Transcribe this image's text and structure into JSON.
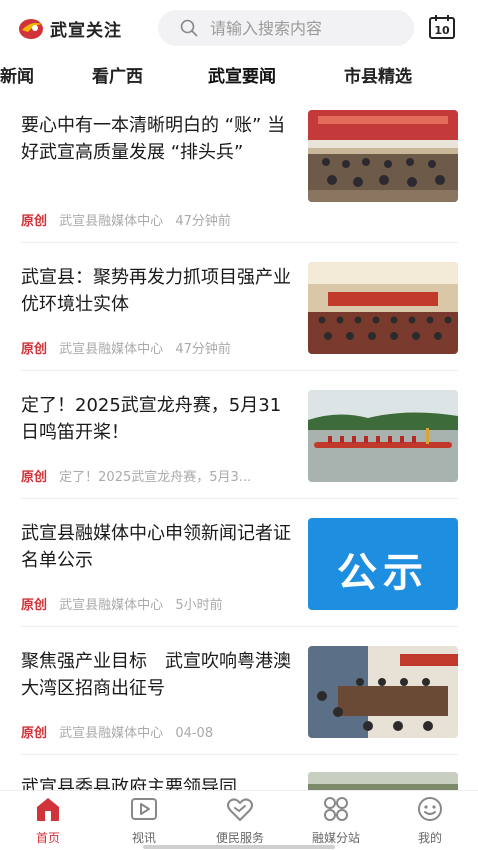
{
  "header": {
    "logo_text": "武宣关注",
    "search_placeholder": "请输入搜索内容",
    "calendar_day": "10"
  },
  "tabs": [
    {
      "label": "新闻"
    },
    {
      "label": "看广西"
    },
    {
      "label": "武宣要闻"
    },
    {
      "label": "市县精选"
    }
  ],
  "feed": [
    {
      "title": "要心中有一本清晰明白的 “账” 当好武宣高质量发展 “排头兵”",
      "tag": "原创",
      "source": "武宣县融媒体中心",
      "time": "47分钟前"
    },
    {
      "title": "武宣县：聚势再发力抓项目强产业优环境壮实体",
      "tag": "原创",
      "source": "武宣县融媒体中心",
      "time": "47分钟前"
    },
    {
      "title": "定了！2025武宣龙舟赛，5月31日鸣笛开桨！",
      "tag": "原创",
      "source": "定了！2025武宣龙舟赛，5月3...",
      "time": ""
    },
    {
      "title": "武宣县融媒体中心申领新闻记者证名单公示",
      "tag": "原创",
      "source": "武宣县融媒体中心",
      "time": "5小时前",
      "thumb_text": "公示"
    },
    {
      "title": "聚焦强产业目标　武宣吹响粤港澳大湾区招商出征号",
      "tag": "原创",
      "source": "武宣县融媒体中心",
      "time": "04-08"
    },
    {
      "title": "武宣县委县政府主要领导同",
      "tag": "",
      "source": "",
      "time": ""
    }
  ],
  "tabbar": [
    {
      "label": "首页",
      "icon": "home-icon"
    },
    {
      "label": "视讯",
      "icon": "video-icon"
    },
    {
      "label": "便民服务",
      "icon": "heart-service-icon"
    },
    {
      "label": "融媒分站",
      "icon": "grid-icon"
    },
    {
      "label": "我的",
      "icon": "smile-face-icon"
    }
  ],
  "colors": {
    "accent": "#d0333a",
    "meta": "#aaaaaa",
    "search_bg": "#f2f2f4"
  }
}
